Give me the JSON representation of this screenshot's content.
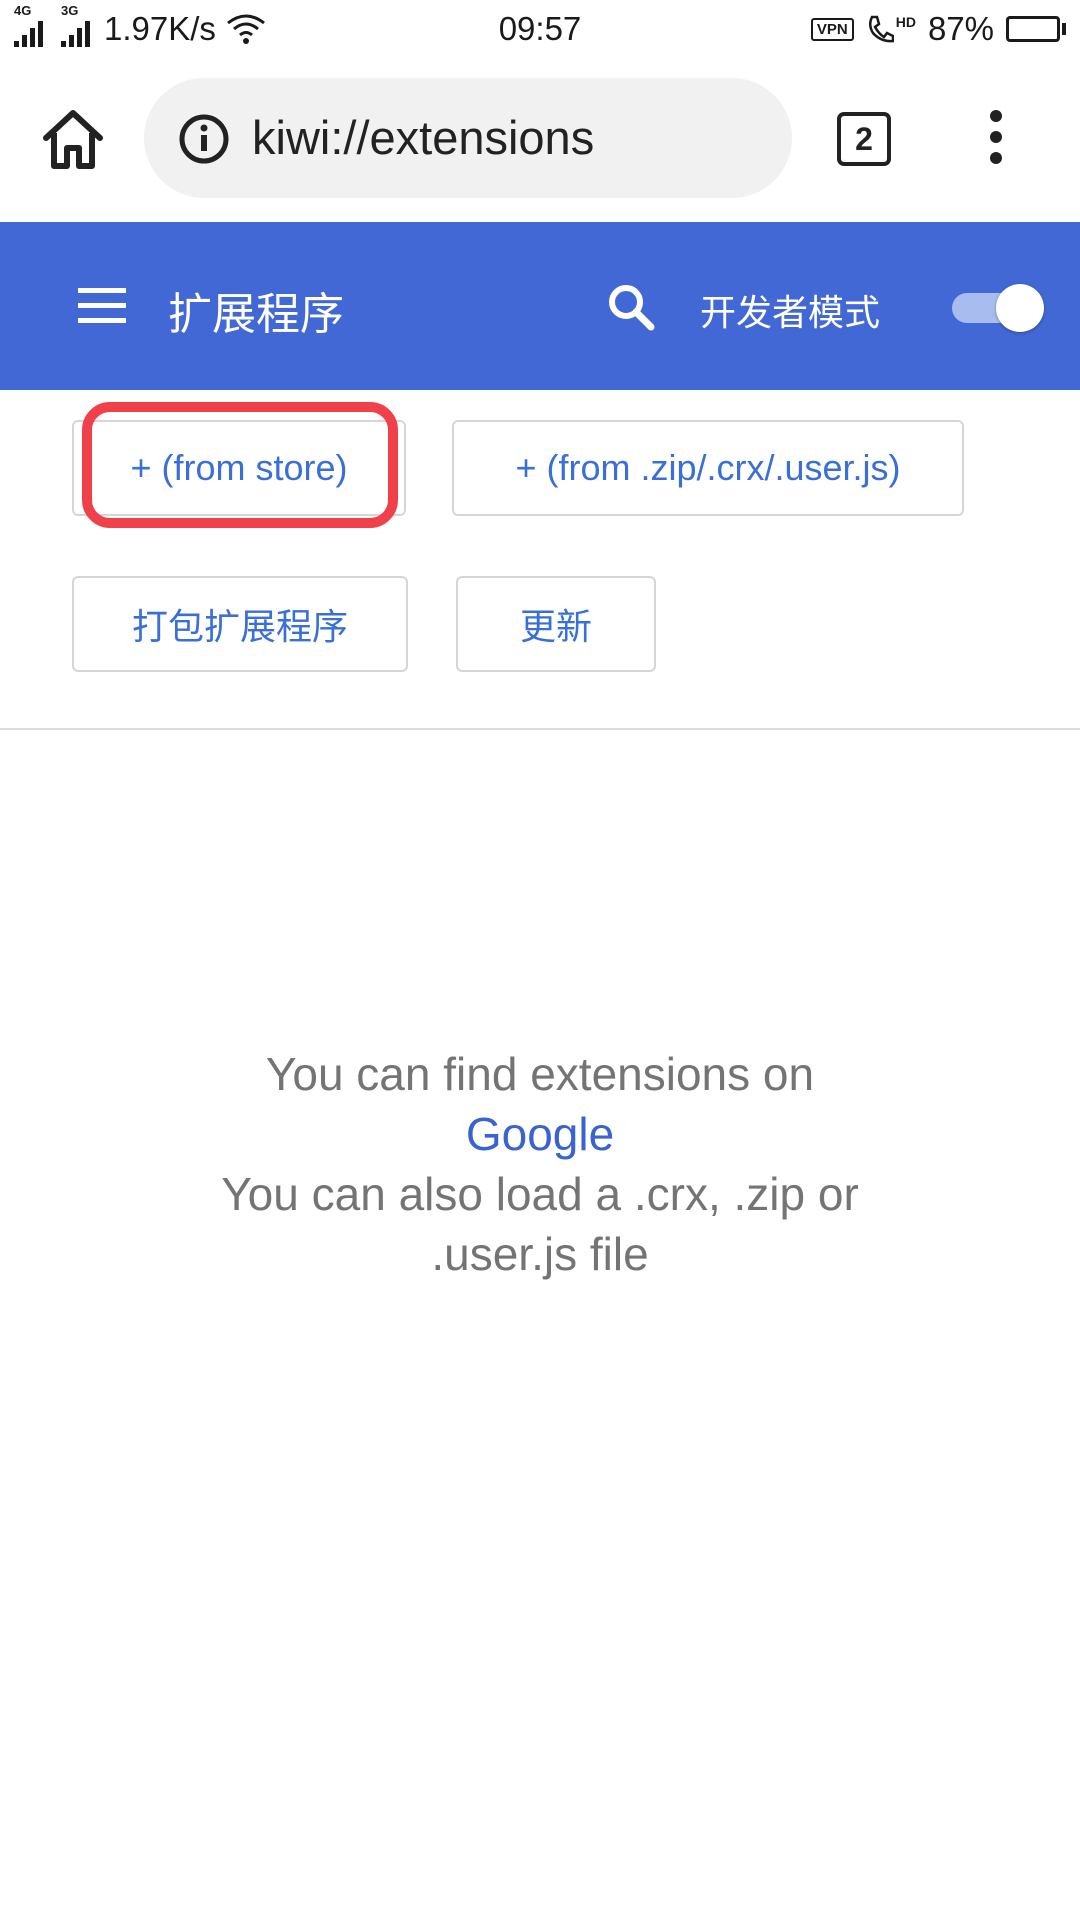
{
  "status_bar": {
    "network_1": "4G",
    "network_2": "3G",
    "speed": "1.97K/s",
    "time": "09:57",
    "vpn": "VPN",
    "hd": "HD",
    "battery": "87%",
    "battery_level": 0.87
  },
  "browser": {
    "url": "kiwi://extensions",
    "tab_count": "2"
  },
  "header": {
    "title": "扩展程序",
    "developer_mode_label": "开发者模式",
    "developer_mode_on": true,
    "accent_color": "#4168d5"
  },
  "actions": {
    "from_store": "+ (from store)",
    "from_file": "+ (from .zip/.crx/.user.js)",
    "pack": "打包扩展程序",
    "update": "更新",
    "highlight_color": "#f0414a"
  },
  "empty_state": {
    "line1": "You can find extensions on",
    "link": "Google",
    "line2": "You can also load a .crx, .zip or",
    "line3": ".user.js file"
  },
  "icons": [
    "signal-icon",
    "wifi-icon",
    "vpn-icon",
    "hd-call-icon",
    "battery-icon",
    "home-icon",
    "info-icon",
    "tabs-icon",
    "more-vert-icon",
    "menu-icon",
    "search-icon",
    "toggle-icon"
  ]
}
